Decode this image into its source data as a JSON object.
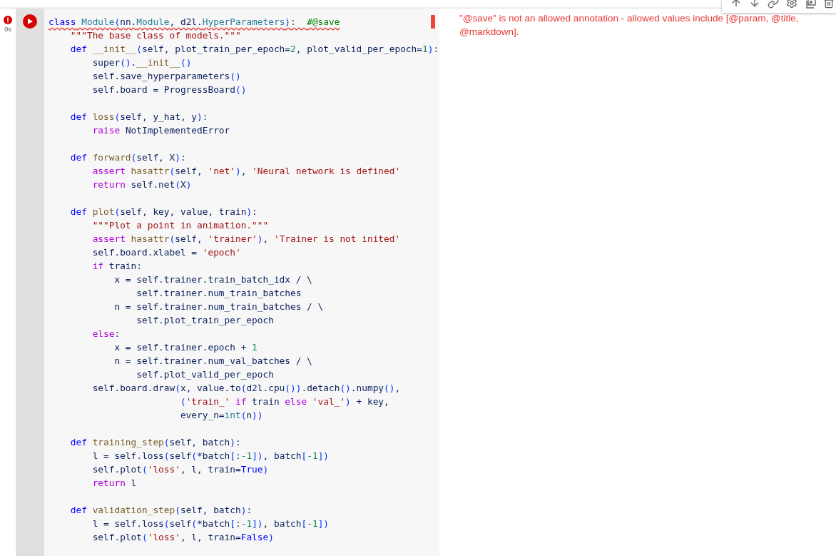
{
  "cell": {
    "kind": "error",
    "exec_time": "0s",
    "code_blocks": [
      [
        {
          "wavy": true,
          "t": [
            {
              "kind": "kw",
              "text": "class"
            },
            {
              "kind": "cls",
              "text": " Module"
            },
            {
              "kind": "br",
              "text": "("
            },
            {
              "kind": "p",
              "text": "nn."
            },
            {
              "kind": "cls",
              "text": "Module"
            },
            {
              "kind": "p",
              "text": ", d2l."
            },
            {
              "kind": "cls",
              "text": "HyperParameters"
            },
            {
              "kind": "br",
              "text": ")"
            },
            {
              "kind": "p",
              "text": ":  "
            },
            {
              "kind": "cmt",
              "text": "#@save"
            }
          ]
        },
        {
          "wavy": false,
          "t": [
            {
              "kind": "str",
              "text": "    \"\"\"The base class of models.\"\"\""
            }
          ]
        },
        {
          "wavy": false,
          "t": [
            {
              "kind": "kw",
              "text": "    def"
            },
            {
              "kind": "fn",
              "text": " __init__"
            },
            {
              "kind": "br",
              "text": "("
            },
            {
              "kind": "p",
              "text": "self, plot_train_per_epoch="
            },
            {
              "kind": "num",
              "text": "2"
            },
            {
              "kind": "p",
              "text": ", plot_valid_per_epoch="
            },
            {
              "kind": "num",
              "text": "1"
            },
            {
              "kind": "br",
              "text": ")"
            },
            {
              "kind": "p",
              "text": ":"
            }
          ]
        },
        {
          "wavy": false,
          "t": [
            {
              "kind": "p",
              "text": "        super"
            },
            {
              "kind": "br",
              "text": "()"
            },
            {
              "kind": "p",
              "text": "."
            },
            {
              "kind": "fn",
              "text": "__init__"
            },
            {
              "kind": "br",
              "text": "()"
            }
          ]
        },
        {
          "wavy": false,
          "t": [
            {
              "kind": "p",
              "text": "        self.save_hyperparameters"
            },
            {
              "kind": "br",
              "text": "()"
            }
          ]
        },
        {
          "wavy": false,
          "t": [
            {
              "kind": "p",
              "text": "        self.board = ProgressBoard"
            },
            {
              "kind": "br",
              "text": "()"
            }
          ]
        }
      ],
      [
        {
          "wavy": false,
          "t": [
            {
              "kind": "kw",
              "text": "    def"
            },
            {
              "kind": "fn",
              "text": " loss"
            },
            {
              "kind": "br",
              "text": "("
            },
            {
              "kind": "p",
              "text": "self, y_hat, y"
            },
            {
              "kind": "br",
              "text": ")"
            },
            {
              "kind": "p",
              "text": ":"
            }
          ]
        },
        {
          "wavy": false,
          "t": [
            {
              "kind": "ctl",
              "text": "        raise"
            },
            {
              "kind": "p",
              "text": " NotImplementedError"
            }
          ]
        }
      ],
      [
        {
          "wavy": false,
          "t": [
            {
              "kind": "kw",
              "text": "    def"
            },
            {
              "kind": "fn",
              "text": " forward"
            },
            {
              "kind": "br",
              "text": "("
            },
            {
              "kind": "p",
              "text": "self, X"
            },
            {
              "kind": "br",
              "text": ")"
            },
            {
              "kind": "p",
              "text": ":"
            }
          ]
        },
        {
          "wavy": false,
          "t": [
            {
              "kind": "ctl",
              "text": "        assert"
            },
            {
              "kind": "fn",
              "text": " hasattr"
            },
            {
              "kind": "br",
              "text": "("
            },
            {
              "kind": "p",
              "text": "self, "
            },
            {
              "kind": "str",
              "text": "'net'"
            },
            {
              "kind": "br",
              "text": ")"
            },
            {
              "kind": "p",
              "text": ", "
            },
            {
              "kind": "str",
              "text": "'Neural network is defined'"
            }
          ]
        },
        {
          "wavy": false,
          "t": [
            {
              "kind": "ctl",
              "text": "        return"
            },
            {
              "kind": "p",
              "text": " self.net"
            },
            {
              "kind": "br",
              "text": "("
            },
            {
              "kind": "p",
              "text": "X"
            },
            {
              "kind": "br",
              "text": ")"
            }
          ]
        }
      ],
      [
        {
          "wavy": false,
          "t": [
            {
              "kind": "kw",
              "text": "    def"
            },
            {
              "kind": "fn",
              "text": " plot"
            },
            {
              "kind": "br",
              "text": "("
            },
            {
              "kind": "p",
              "text": "self, key, value, train"
            },
            {
              "kind": "br",
              "text": ")"
            },
            {
              "kind": "p",
              "text": ":"
            }
          ]
        },
        {
          "wavy": false,
          "t": [
            {
              "kind": "str",
              "text": "        \"\"\"Plot a point in animation.\"\"\""
            }
          ]
        },
        {
          "wavy": false,
          "t": [
            {
              "kind": "ctl",
              "text": "        assert"
            },
            {
              "kind": "fn",
              "text": " hasattr"
            },
            {
              "kind": "br",
              "text": "("
            },
            {
              "kind": "p",
              "text": "self, "
            },
            {
              "kind": "str",
              "text": "'trainer'"
            },
            {
              "kind": "br",
              "text": ")"
            },
            {
              "kind": "p",
              "text": ", "
            },
            {
              "kind": "str",
              "text": "'Trainer is not inited'"
            }
          ]
        },
        {
          "wavy": false,
          "t": [
            {
              "kind": "p",
              "text": "        self.board.xlabel = "
            },
            {
              "kind": "str",
              "text": "'epoch'"
            }
          ]
        },
        {
          "wavy": false,
          "t": [
            {
              "kind": "ctl",
              "text": "        if"
            },
            {
              "kind": "p",
              "text": " train:"
            }
          ]
        },
        {
          "wavy": false,
          "t": [
            {
              "kind": "p",
              "text": "            x = self.trainer.train_batch_idx / \\"
            }
          ]
        },
        {
          "wavy": false,
          "t": [
            {
              "kind": "p",
              "text": "                self.trainer.num_train_batches"
            }
          ]
        },
        {
          "wavy": false,
          "t": [
            {
              "kind": "p",
              "text": "            n = self.trainer.num_train_batches / \\"
            }
          ]
        },
        {
          "wavy": false,
          "t": [
            {
              "kind": "p",
              "text": "                self.plot_train_per_epoch"
            }
          ]
        },
        {
          "wavy": false,
          "t": [
            {
              "kind": "ctl",
              "text": "        else"
            },
            {
              "kind": "p",
              "text": ":"
            }
          ]
        },
        {
          "wavy": false,
          "t": [
            {
              "kind": "p",
              "text": "            x = self.trainer.epoch + "
            },
            {
              "kind": "num",
              "text": "1"
            }
          ]
        },
        {
          "wavy": false,
          "t": [
            {
              "kind": "p",
              "text": "            n = self.trainer.num_val_batches / \\"
            }
          ]
        },
        {
          "wavy": false,
          "t": [
            {
              "kind": "p",
              "text": "                self.plot_valid_per_epoch"
            }
          ]
        },
        {
          "wavy": false,
          "t": [
            {
              "kind": "p",
              "text": "        self.board.draw"
            },
            {
              "kind": "br",
              "text": "("
            },
            {
              "kind": "p",
              "text": "x, value.to"
            },
            {
              "kind": "br",
              "text": "("
            },
            {
              "kind": "p",
              "text": "d2l.cpu"
            },
            {
              "kind": "br",
              "text": "())"
            },
            {
              "kind": "p",
              "text": ".detach"
            },
            {
              "kind": "br",
              "text": "()"
            },
            {
              "kind": "p",
              "text": ".numpy"
            },
            {
              "kind": "br",
              "text": "()"
            },
            {
              "kind": "p",
              "text": ","
            }
          ]
        },
        {
          "wavy": false,
          "t": [
            {
              "kind": "br",
              "text": "                        ("
            },
            {
              "kind": "str",
              "text": "'train_'"
            },
            {
              "kind": "ctl",
              "text": " if"
            },
            {
              "kind": "p",
              "text": " train "
            },
            {
              "kind": "ctl",
              "text": "else"
            },
            {
              "kind": "str",
              "text": " 'val_'"
            },
            {
              "kind": "br",
              "text": ")"
            },
            {
              "kind": "p",
              "text": " + key,"
            }
          ]
        },
        {
          "wavy": false,
          "t": [
            {
              "kind": "p",
              "text": "                        every_n="
            },
            {
              "kind": "cls",
              "text": "int"
            },
            {
              "kind": "br",
              "text": "("
            },
            {
              "kind": "p",
              "text": "n"
            },
            {
              "kind": "br",
              "text": "))"
            }
          ]
        }
      ],
      [
        {
          "wavy": false,
          "t": [
            {
              "kind": "kw",
              "text": "    def"
            },
            {
              "kind": "fn",
              "text": " training_step"
            },
            {
              "kind": "br",
              "text": "("
            },
            {
              "kind": "p",
              "text": "self, batch"
            },
            {
              "kind": "br",
              "text": ")"
            },
            {
              "kind": "p",
              "text": ":"
            }
          ]
        },
        {
          "wavy": false,
          "t": [
            {
              "kind": "p",
              "text": "        l = self.loss"
            },
            {
              "kind": "br",
              "text": "("
            },
            {
              "kind": "p",
              "text": "self"
            },
            {
              "kind": "br",
              "text": "("
            },
            {
              "kind": "p",
              "text": "*batch"
            },
            {
              "kind": "br",
              "text": "["
            },
            {
              "kind": "p",
              "text": ":"
            },
            {
              "kind": "num",
              "text": "-1"
            },
            {
              "kind": "br",
              "text": "])"
            },
            {
              "kind": "p",
              "text": ", batch"
            },
            {
              "kind": "br",
              "text": "["
            },
            {
              "kind": "num",
              "text": "-1"
            },
            {
              "kind": "br",
              "text": "])"
            }
          ]
        },
        {
          "wavy": false,
          "t": [
            {
              "kind": "p",
              "text": "        self.plot"
            },
            {
              "kind": "br",
              "text": "("
            },
            {
              "kind": "str",
              "text": "'loss'"
            },
            {
              "kind": "p",
              "text": ", l, train="
            },
            {
              "kind": "kw",
              "text": "True"
            },
            {
              "kind": "br",
              "text": ")"
            }
          ]
        },
        {
          "wavy": false,
          "t": [
            {
              "kind": "ctl",
              "text": "        return"
            },
            {
              "kind": "p",
              "text": " l"
            }
          ]
        }
      ],
      [
        {
          "wavy": false,
          "t": [
            {
              "kind": "kw",
              "text": "    def"
            },
            {
              "kind": "fn",
              "text": " validation_step"
            },
            {
              "kind": "br",
              "text": "("
            },
            {
              "kind": "p",
              "text": "self, batch"
            },
            {
              "kind": "br",
              "text": ")"
            },
            {
              "kind": "p",
              "text": ":"
            }
          ]
        },
        {
          "wavy": false,
          "t": [
            {
              "kind": "p",
              "text": "        l = self.loss"
            },
            {
              "kind": "br",
              "text": "("
            },
            {
              "kind": "p",
              "text": "self"
            },
            {
              "kind": "br",
              "text": "("
            },
            {
              "kind": "p",
              "text": "*batch"
            },
            {
              "kind": "br",
              "text": "["
            },
            {
              "kind": "p",
              "text": ":"
            },
            {
              "kind": "num",
              "text": "-1"
            },
            {
              "kind": "br",
              "text": "])"
            },
            {
              "kind": "p",
              "text": ", batch"
            },
            {
              "kind": "br",
              "text": "["
            },
            {
              "kind": "num",
              "text": "-1"
            },
            {
              "kind": "br",
              "text": "])"
            }
          ]
        },
        {
          "wavy": false,
          "t": [
            {
              "kind": "p",
              "text": "        self.plot"
            },
            {
              "kind": "br",
              "text": "("
            },
            {
              "kind": "str",
              "text": "'loss'"
            },
            {
              "kind": "p",
              "text": ", l, train="
            },
            {
              "kind": "kw",
              "text": "False"
            },
            {
              "kind": "br",
              "text": ")"
            }
          ]
        }
      ]
    ],
    "error_message": "\"@save\" is not an allowed annotation - allowed values include [@param, @title, @markdown]."
  }
}
